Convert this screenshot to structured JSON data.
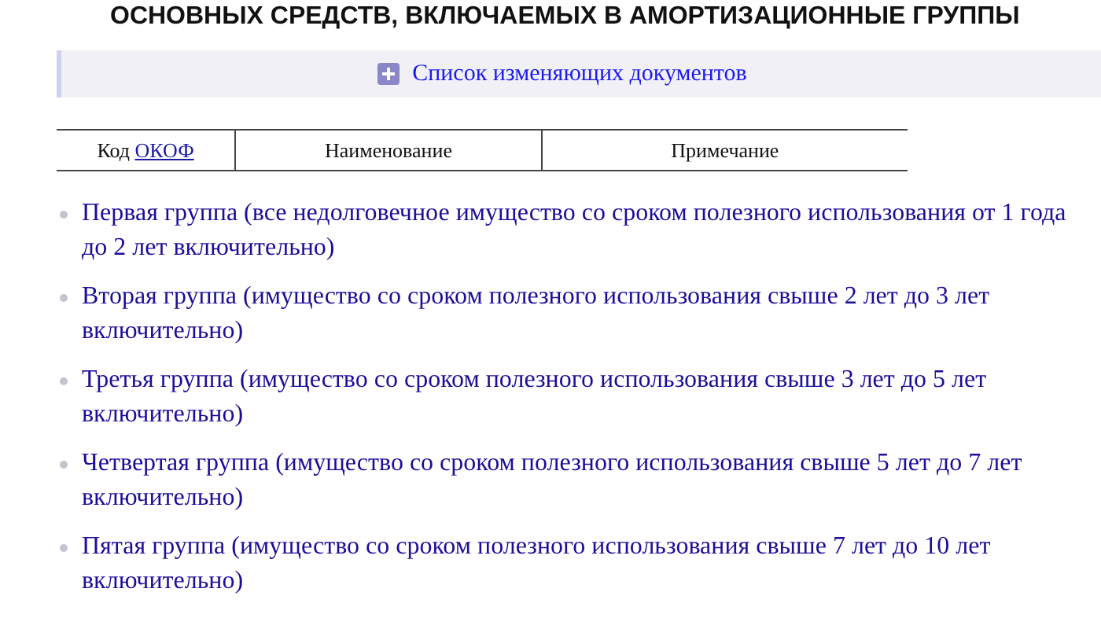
{
  "heading": "ОСНОВНЫХ СРЕДСТВ, ВКЛЮЧАЕМЫХ В АМОРТИЗАЦИОННЫЕ ГРУППЫ",
  "amendments": {
    "label": "Список изменяющих документов",
    "expanded": false
  },
  "table": {
    "columns": [
      {
        "text": "Код ",
        "link": "ОКОФ"
      },
      {
        "text": "Наименование"
      },
      {
        "text": "Примечание"
      }
    ]
  },
  "groups": [
    "Первая группа (все недолговечное имущество со сроком полезного использования от 1 года до 2 лет включительно)",
    "Вторая группа (имущество со сроком полезного использования свыше 2 лет до 3 лет включительно)",
    "Третья группа (имущество со сроком полезного использования свыше 3 лет до 5 лет включительно)",
    "Четвертая группа (имущество со сроком полезного использования свыше 5 лет до 7 лет включительно)",
    "Пятая группа (имущество со сроком полезного использования свыше 7 лет до 10 лет включительно)"
  ]
}
